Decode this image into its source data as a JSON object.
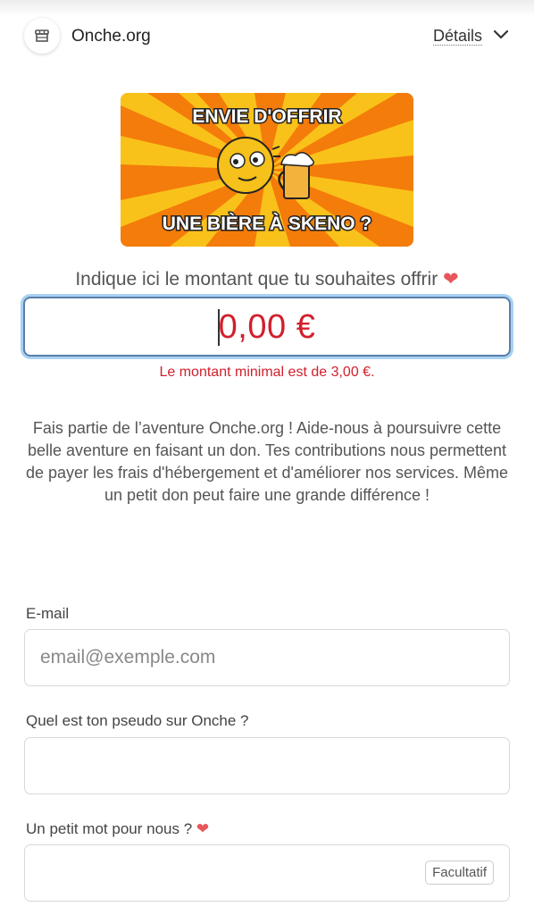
{
  "header": {
    "site_name": "Onche.org",
    "details_label": "Détails",
    "logo_icon": "storefront-icon",
    "chevron_icon": "chevron-down-icon"
  },
  "banner": {
    "line1": "ENVIE D'OFFRIR",
    "line2": "UNE BIÈRE À SKENO ?"
  },
  "donation": {
    "prompt": "Indique ici le montant que tu souhaites offrir",
    "amount": "0,00 €",
    "error": "Le montant minimal est de 3,00 €.",
    "description": "Fais partie de l’aventure Onche.org ! Aide-nous à poursuivre cette belle aventure en faisant un don. Tes contributions nous permettent de payer les frais d'hébergement et d'améliorer nos services. Même un petit don peut faire une grande différence !"
  },
  "form": {
    "email_label": "E-mail",
    "email_placeholder": "email@exemple.com",
    "pseudo_label": "Quel est ton pseudo sur Onche ?",
    "message_label": "Un petit mot pour nous ?",
    "optional_label": "Facultatif"
  },
  "colors": {
    "accent_red": "#d11f2c",
    "focus_ring": "#a9d1f2",
    "banner_orange": "#f47c0a",
    "banner_yellow": "#f9c21a"
  }
}
